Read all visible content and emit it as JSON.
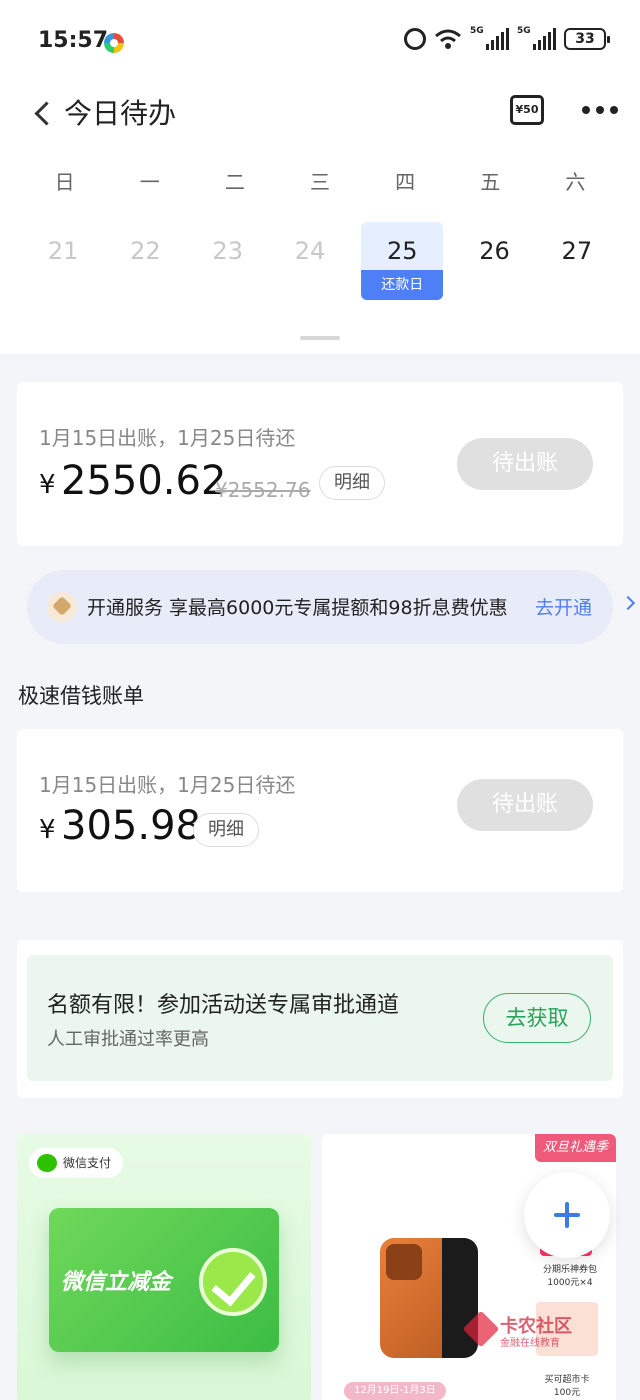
{
  "status_bar": {
    "time": "15:57",
    "network_1": "5G",
    "network_2": "5G",
    "battery": "33"
  },
  "nav": {
    "title": "今日待办",
    "coupon_label": "¥50"
  },
  "calendar": {
    "weekdays": [
      "日",
      "一",
      "二",
      "三",
      "四",
      "五",
      "六"
    ],
    "dates": [
      "21",
      "22",
      "23",
      "24",
      "25",
      "26",
      "27"
    ],
    "today_tag": "还款日"
  },
  "bill_main": {
    "meta": "1月15日出账，1月25日待还",
    "currency": "¥",
    "amount": "2550.62",
    "original_amount": "¥2552.76",
    "detail_label": "明细",
    "status_label": "待出账"
  },
  "promo": {
    "text": "开通服务 享最高6000元专属提额和98折息费优惠",
    "link": "去开通"
  },
  "quick_loan": {
    "section_title": "极速借钱账单",
    "meta": "1月15日出账，1月25日待还",
    "currency": "¥",
    "amount": "305.98",
    "detail_label": "明细",
    "status_label": "待出账"
  },
  "activity": {
    "title": "名额有限！参加活动送专属审批通道",
    "subtitle": "人工审批通过率更高",
    "button": "去获取"
  },
  "banner_left": {
    "tag": "微信支付",
    "card_text": "微信立减金"
  },
  "banner_right": {
    "tag": "双旦礼遇季",
    "side_text_1": "分期乐神券包 1000元×4",
    "side_text_2": "买可超市卡 100元",
    "date_text": "12月19日-1月3日"
  },
  "watermark": {
    "text": "卡农社区",
    "sub": "金融在线教育"
  },
  "colors": {
    "accent": "#4e7ff6",
    "green": "#2aa35b",
    "pending_button": "#e0e0e0"
  }
}
